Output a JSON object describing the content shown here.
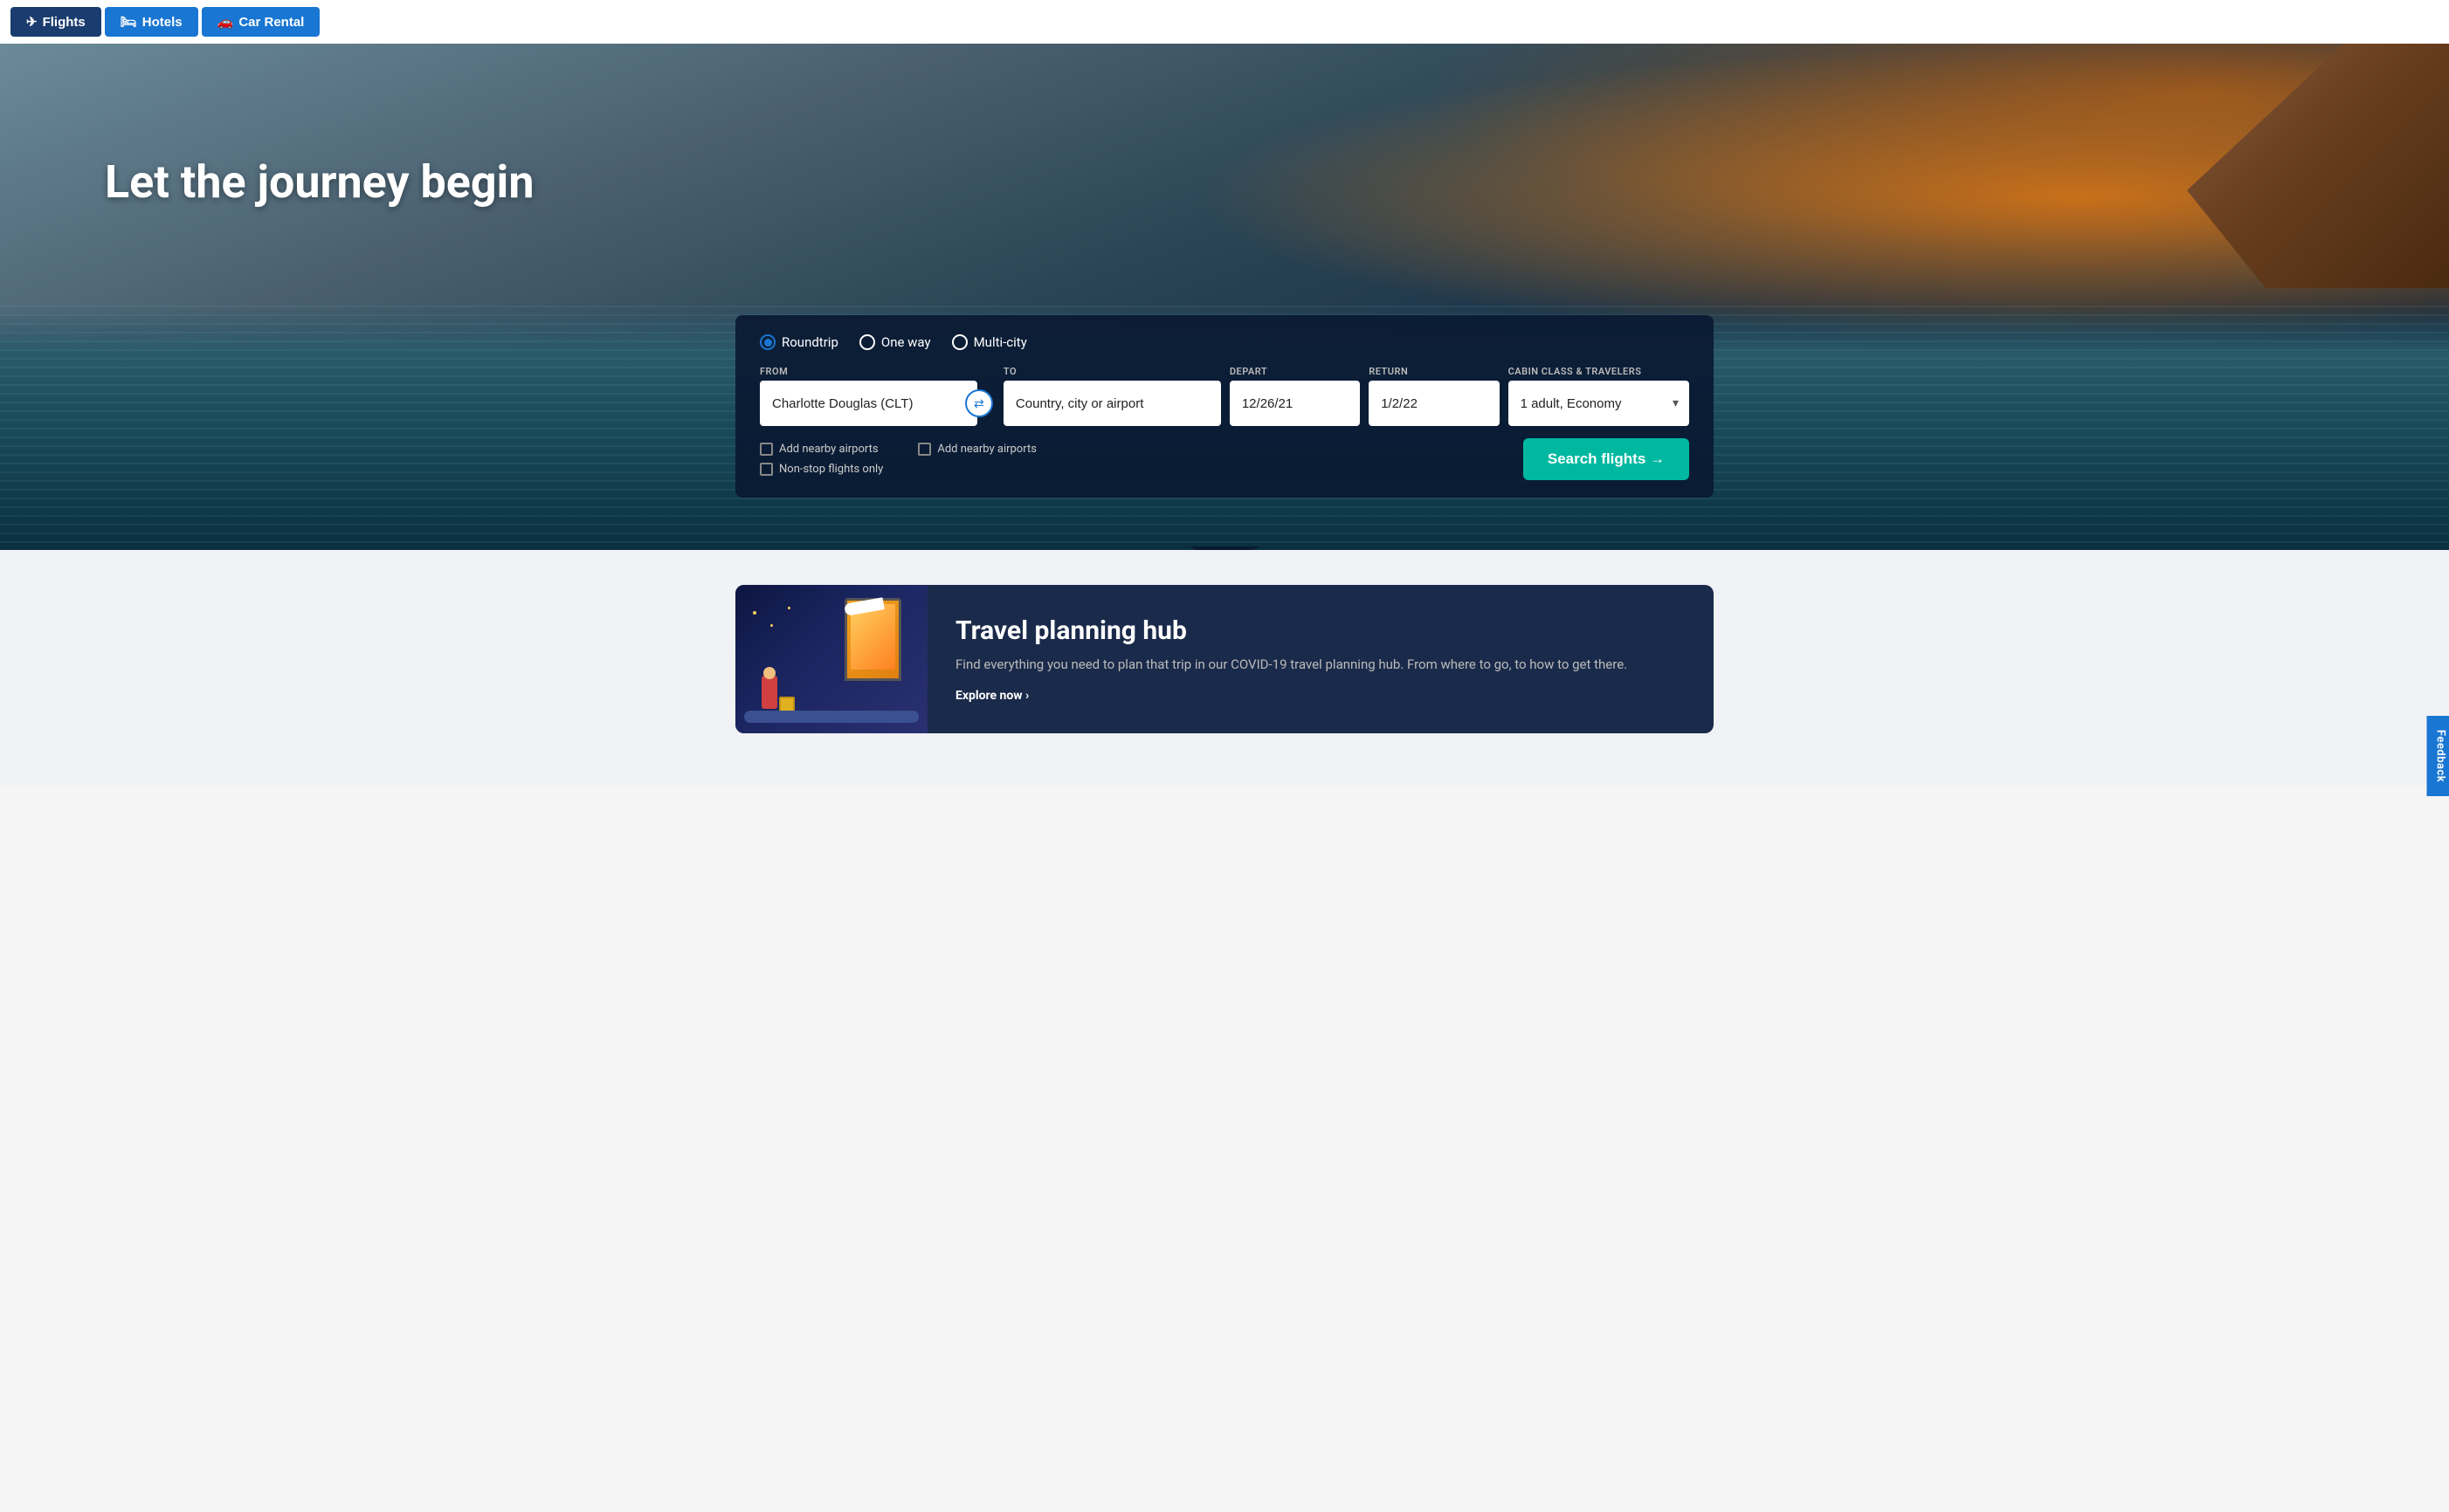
{
  "nav": {
    "tabs": [
      {
        "id": "flights",
        "label": "Flights",
        "icon": "✈",
        "active": true
      },
      {
        "id": "hotels",
        "label": "Hotels",
        "icon": "🛏",
        "active": false
      },
      {
        "id": "car-rental",
        "label": "Car Rental",
        "icon": "🚗",
        "active": false
      }
    ]
  },
  "hero": {
    "title": "Let the journey begin"
  },
  "search": {
    "trip_types": [
      {
        "id": "roundtrip",
        "label": "Roundtrip",
        "selected": true
      },
      {
        "id": "one-way",
        "label": "One way",
        "selected": false
      },
      {
        "id": "multi-city",
        "label": "Multi-city",
        "selected": false
      }
    ],
    "from_label": "From",
    "from_value": "Charlotte Douglas (CLT)",
    "to_label": "To",
    "to_placeholder": "Country, city or airport",
    "depart_label": "Depart",
    "depart_value": "12/26/21",
    "return_label": "Return",
    "return_value": "1/2/22",
    "cabin_label": "Cabin Class & Travelers",
    "cabin_value": "1 adult, Economy",
    "checkboxes": [
      {
        "id": "nearby-from",
        "label": "Add nearby airports",
        "checked": false
      },
      {
        "id": "nonstop",
        "label": "Non-stop flights only",
        "checked": false
      },
      {
        "id": "nearby-to",
        "label": "Add nearby airports",
        "checked": false
      }
    ],
    "search_button": "Search flights →"
  },
  "hub": {
    "title": "Travel planning hub",
    "description": "Find everything you need to plan that trip in our COVID-19 travel planning hub. From where to go, to how to get there.",
    "link_label": "Explore now ›"
  },
  "feedback": {
    "label": "Feedback"
  }
}
